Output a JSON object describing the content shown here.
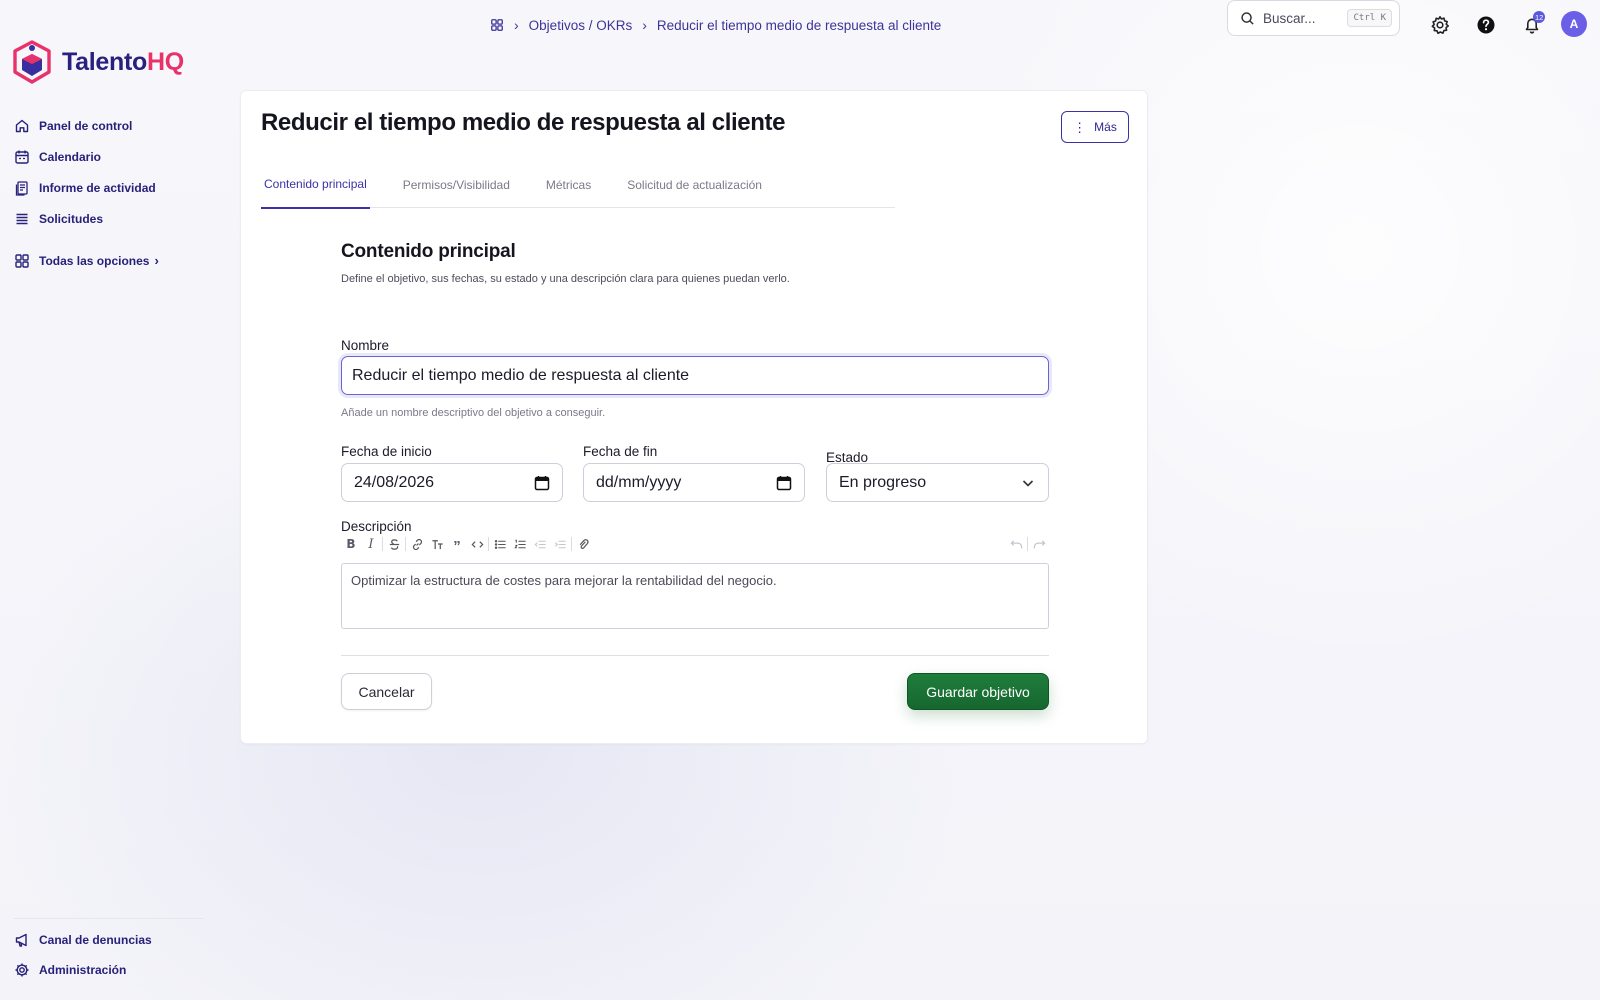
{
  "app": {
    "brand_main": "Talento",
    "brand_accent": "HQ",
    "accent_color": "#3b32a8",
    "brand_color": "#e8336a",
    "success_color": "#1a7435"
  },
  "sidebar": {
    "items": [
      {
        "label": "Panel de control",
        "icon": "home-icon"
      },
      {
        "label": "Calendario",
        "icon": "calendar-icon"
      },
      {
        "label": "Informe de actividad",
        "icon": "report-icon"
      },
      {
        "label": "Solicitudes",
        "icon": "list-icon"
      }
    ],
    "all_options": {
      "label": "Todas las opciones",
      "icon": "grid-icon"
    },
    "bottom_items": [
      {
        "label": "Canal de denuncias",
        "icon": "megaphone-icon"
      },
      {
        "label": "Administración",
        "icon": "gear-icon"
      }
    ]
  },
  "breadcrumb": {
    "items": [
      "Objetivos / OKRs",
      "Reducir el tiempo medio de respuesta al cliente"
    ]
  },
  "topbar": {
    "search_placeholder": "Buscar...",
    "search_shortcut": "Ctrl K",
    "notifications_count": "12",
    "avatar_initial": "A"
  },
  "page": {
    "title": "Reducir el tiempo medio de respuesta al cliente",
    "more_label": "Más",
    "tabs": [
      {
        "label": "Contenido principal",
        "active": true
      },
      {
        "label": "Permisos/Visibilidad",
        "active": false
      },
      {
        "label": "Métricas",
        "active": false
      },
      {
        "label": "Solicitud de actualización",
        "active": false
      }
    ]
  },
  "form": {
    "section_title": "Contenido principal",
    "section_description": "Define el objetivo, sus fechas, su estado y una descripción clara para quienes puedan verlo.",
    "name_label": "Nombre",
    "name_value": "Reducir el tiempo medio de respuesta al cliente",
    "name_help": "Añade un nombre descriptivo del objetivo a conseguir.",
    "start_label": "Fecha de inicio",
    "start_value": "24/08/2026",
    "end_label": "Fecha de fin",
    "end_value": "dd/mm/yyyy",
    "status_label": "Estado",
    "status_value": "En progreso",
    "description_label": "Descripción",
    "description_value": "Optimizar la estructura de costes para mejorar la rentabilidad del negocio.",
    "cancel_label": "Cancelar",
    "save_label": "Guardar objetivo"
  }
}
